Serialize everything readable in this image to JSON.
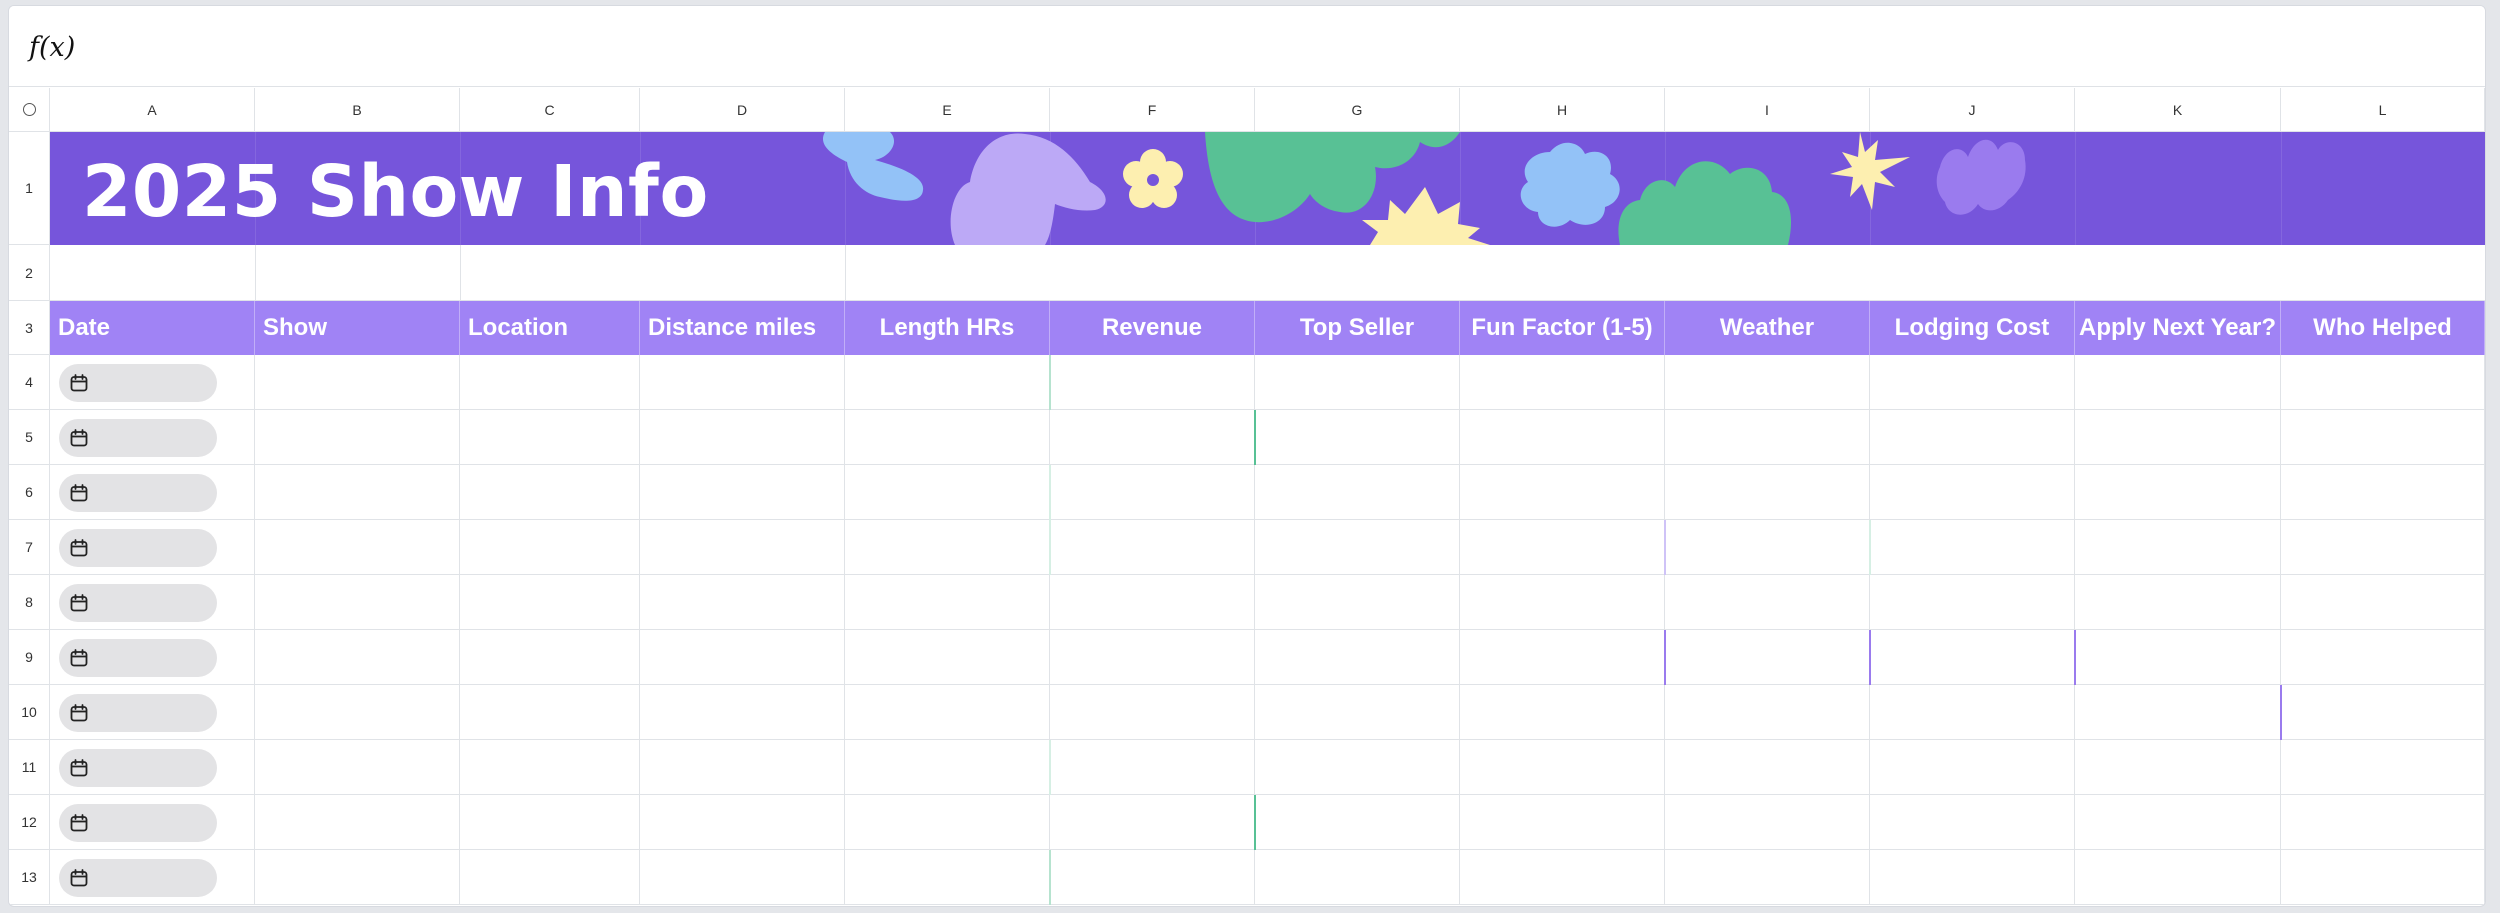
{
  "formula_bar": {
    "label": "f(x)"
  },
  "columns": [
    "A",
    "B",
    "C",
    "D",
    "E",
    "F",
    "G",
    "H",
    "I",
    "J",
    "K",
    "L"
  ],
  "rows": [
    "1",
    "2",
    "3",
    "4",
    "5",
    "6",
    "7",
    "8",
    "9",
    "10",
    "11",
    "12",
    "13"
  ],
  "banner": {
    "title": "2025 Show Info",
    "background": "#7655db"
  },
  "headers": [
    "Date",
    "Show",
    "Location",
    "Distance miles",
    "Length HRs",
    "Revenue",
    "Top Seller",
    "Fun Factor (1-5)",
    "Weather",
    "Lodging Cost",
    "Apply Next Year?",
    "Who Helped"
  ],
  "header_color": "#a083f5",
  "date_icon": "calendar-icon",
  "colors": {
    "purple_banner": "#7655db",
    "header_purple": "#a083f5",
    "shape_blue": "#93c2f7",
    "shape_lavender": "#bca9f6",
    "shape_yellow": "#fdefb0",
    "shape_green": "#58c195",
    "shape_violet": "#9a7bee"
  }
}
